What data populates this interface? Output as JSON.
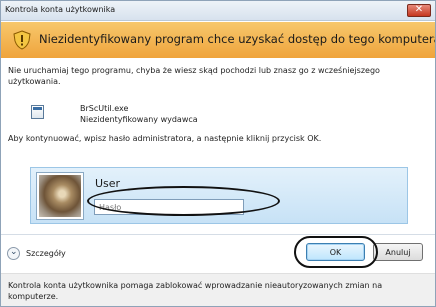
{
  "window": {
    "title": "Kontrola konta użytkownika",
    "close_glyph": "✕"
  },
  "banner": {
    "text": "Niezidentyfikowany program chce uzyskać dostęp do tego komputera",
    "icon": "shield-warning-icon",
    "color": "#efa43c"
  },
  "warning_text": "Nie uruchamiaj tego programu, chyba że wiesz skąd pochodzi lub znasz go z wcześniejszego użytkowania.",
  "program": {
    "name": "BrScUtil.exe",
    "publisher": "Niezidentyfikowany wydawca",
    "icon": "application-icon"
  },
  "instruction": "Aby kontynuować, wpisz hasło administratora, a następnie kliknij przycisk OK.",
  "credentials": {
    "user_label": "User",
    "password_placeholder": "Hasło",
    "avatar_icon": "user-avatar-cat"
  },
  "details": {
    "label": "Szczegóły",
    "icon": "chevron-down-icon"
  },
  "buttons": {
    "ok": "OK",
    "cancel": "Anuluj"
  },
  "footer_text": "Kontrola konta użytkownika pomaga zablokować wprowadzanie nieautoryzowanych zmian na komputerze."
}
